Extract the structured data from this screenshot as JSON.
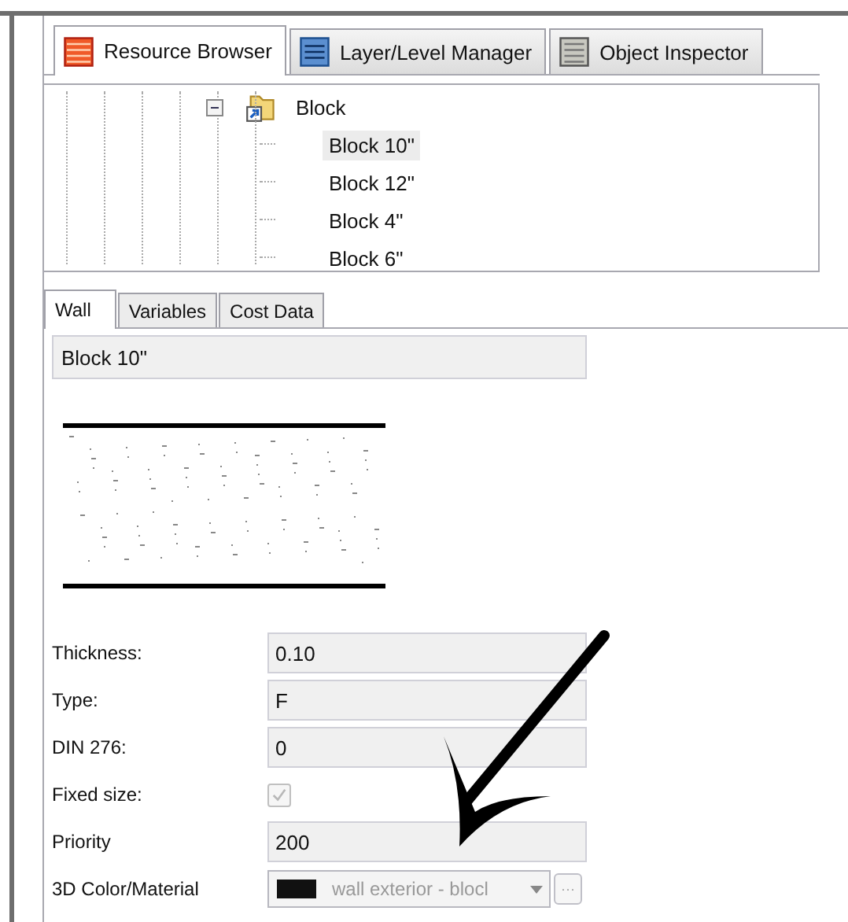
{
  "tabs": [
    {
      "label": "Resource Browser",
      "kind": "resource",
      "selected": true
    },
    {
      "label": "Layer/Level Manager",
      "kind": "layer",
      "selected": false
    },
    {
      "label": "Object Inspector",
      "kind": "inspector",
      "selected": false
    }
  ],
  "tree": [
    {
      "label": "Block",
      "expanded": true,
      "children": [
        {
          "label": "Block 10\"",
          "selected": true
        },
        {
          "label": "Block 12\"",
          "selected": false
        },
        {
          "label": "Block 4\"",
          "selected": false
        },
        {
          "label": "Block 6\"",
          "selected": false
        }
      ]
    }
  ],
  "subtabs": [
    {
      "label": "Wall",
      "selected": true
    },
    {
      "label": "Variables",
      "selected": false
    },
    {
      "label": "Cost Data",
      "selected": false
    }
  ],
  "name_field": {
    "value": "Block 10\""
  },
  "fields": [
    {
      "kind": "text",
      "label": "Thickness:",
      "value": "0.10"
    },
    {
      "kind": "text",
      "label": "Type:",
      "value": "F"
    },
    {
      "kind": "text",
      "label": "DIN 276:",
      "value": "0"
    },
    {
      "kind": "checkbox",
      "label": "Fixed size:",
      "checked": true,
      "disabled": true
    },
    {
      "kind": "text",
      "label": "Priority",
      "value": "200"
    },
    {
      "kind": "material",
      "label": "3D Color/Material",
      "value": "wall exterior - blocl",
      "color": "#111111",
      "button": "···"
    }
  ]
}
